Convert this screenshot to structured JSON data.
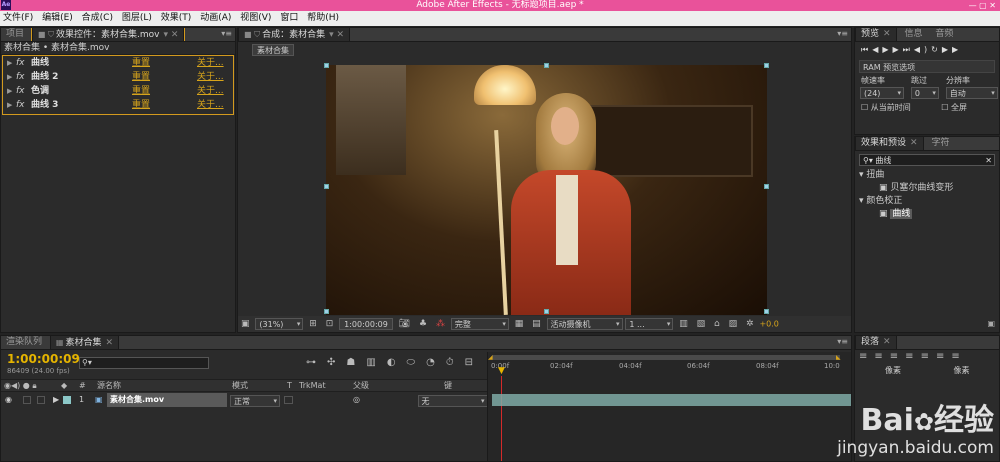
{
  "window": {
    "title": "Adobe After Effects - 无标题项目.aep *",
    "app_icon": "Ae",
    "controls": "—  ▢  ✕"
  },
  "menu": [
    "文件(F)",
    "编辑(E)",
    "合成(C)",
    "图层(L)",
    "效果(T)",
    "动画(A)",
    "视图(V)",
    "窗口",
    "帮助(H)"
  ],
  "left_panel": {
    "tabs": [
      "项目",
      "效果控件：素材合集.mov"
    ],
    "breadcrumb": "素材合集 • 素材合集.mov",
    "effects": [
      {
        "tag": "fx",
        "name": "曲线",
        "reset": "重置",
        "about": "关于..."
      },
      {
        "tag": "fx",
        "name": "曲线 2",
        "reset": "重置",
        "about": "关于..."
      },
      {
        "tag": "fx",
        "name": "色调",
        "reset": "重置",
        "about": "关于..."
      },
      {
        "tag": "fx",
        "name": "曲线 3",
        "reset": "重置",
        "about": "关于..."
      }
    ]
  },
  "comp_panel": {
    "tab": "合成：素材合集",
    "sub_tab": "素材合集",
    "toolbar": {
      "zoom": "(31%)",
      "timecode": "1:00:00:09",
      "quality": "完整",
      "camera": "活动摄像机",
      "views": "1 ...",
      "exposure": "+0.0"
    }
  },
  "preview_panel": {
    "tabs": [
      "预览",
      "信息",
      "音频"
    ],
    "ram_options": "RAM 预览选项",
    "labels": {
      "frame_rate": "帧速率",
      "skip": "跳过",
      "resolution": "分辨率"
    },
    "values": {
      "frame_rate": "(24)",
      "skip": "0",
      "resolution": "自动"
    },
    "checkbox_current": "从当前时间",
    "checkbox_full": "全屏"
  },
  "effects_presets": {
    "tabs": [
      "效果和预设",
      "字符"
    ],
    "search": "曲线",
    "tree": [
      {
        "level": 0,
        "label": "扭曲"
      },
      {
        "level": 1,
        "label": "贝塞尔曲线变形"
      },
      {
        "level": 0,
        "label": "颜色校正"
      },
      {
        "level": 1,
        "label": "曲线"
      }
    ]
  },
  "timeline": {
    "tabs": [
      "渲染队列",
      "素材合集"
    ],
    "timecode": "1:00:00:09",
    "frames": "86409 (24.00 fps)",
    "search_placeholder": "",
    "columns": {
      "source": "源名称",
      "mode": "模式",
      "t": "T",
      "trkmat": "TrkMat",
      "parent": "父级",
      "key": "键"
    },
    "layer": {
      "num": "1",
      "name": "素材合集.mov",
      "mode": "正常",
      "parent": "无"
    },
    "ruler": [
      "0:00f",
      "02:04f",
      "04:04f",
      "06:04f",
      "08:04f",
      "10:0"
    ]
  },
  "paragraph_panel": {
    "tabs": [
      "段落"
    ],
    "px1": "像素",
    "px2": "像素"
  },
  "watermark": {
    "brand": "Bai",
    "brand2": "经验",
    "url": "jingyan.baidu.com"
  },
  "colors": {
    "title_bg": "#e9529a",
    "accent_orange": "#d7a41b",
    "timecode": "#e5b400"
  }
}
